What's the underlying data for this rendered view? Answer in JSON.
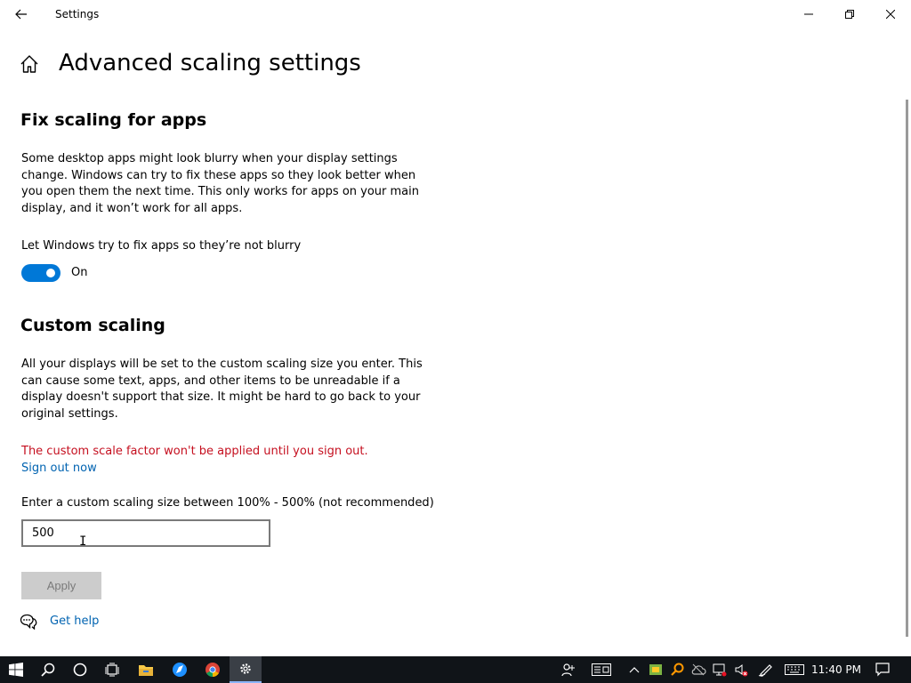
{
  "window": {
    "title": "Settings",
    "back_icon": "back-arrow-icon",
    "minimize_icon": "minimize-icon",
    "restore_icon": "restore-icon",
    "close_icon": "close-icon"
  },
  "header": {
    "home_icon": "home-icon",
    "title": "Advanced scaling settings"
  },
  "fix_scaling": {
    "title": "Fix scaling for apps",
    "description": "Some desktop apps might look blurry when your display settings change. Windows can try to fix these apps so they look better when you open them the next time. This only works for apps on your main display, and it won’t work for all apps.",
    "toggle_label": "Let Windows try to fix apps so they’re not blurry",
    "toggle_on": true,
    "toggle_state": "On"
  },
  "custom_scaling": {
    "title": "Custom scaling",
    "description": "All your displays will be set to the custom scaling size you enter. This can cause some text, apps, and other items to be unreadable if a display doesn't support that size. It might be hard to go back to your original settings.",
    "warning": "The custom scale factor won't be applied until you sign out.",
    "sign_out_link": "Sign out now",
    "input_label": "Enter a custom scaling size between 100% - 500% (not recommended)",
    "input_value": "500",
    "apply_label": "Apply"
  },
  "help": {
    "icon": "help-chat-icon",
    "label": "Get help"
  },
  "colors": {
    "accent": "#0078d7",
    "link": "#0063b1",
    "warning": "#c50f1f",
    "taskbar": "#101418"
  },
  "taskbar": {
    "apps": [
      "start-icon",
      "search-icon",
      "cortana-icon",
      "task-view-icon",
      "file-explorer-icon",
      "browser-icon",
      "chrome-icon",
      "settings-icon"
    ],
    "tray": [
      "people-icon",
      "news-icon",
      "chevron-up-icon",
      "app-tray-icon",
      "search-tray-icon",
      "cloud-icon",
      "network-icon",
      "volume-muted-icon",
      "pen-icon",
      "keyboard-icon"
    ],
    "time": "11:40 PM",
    "notification_icon": "notification-icon"
  }
}
